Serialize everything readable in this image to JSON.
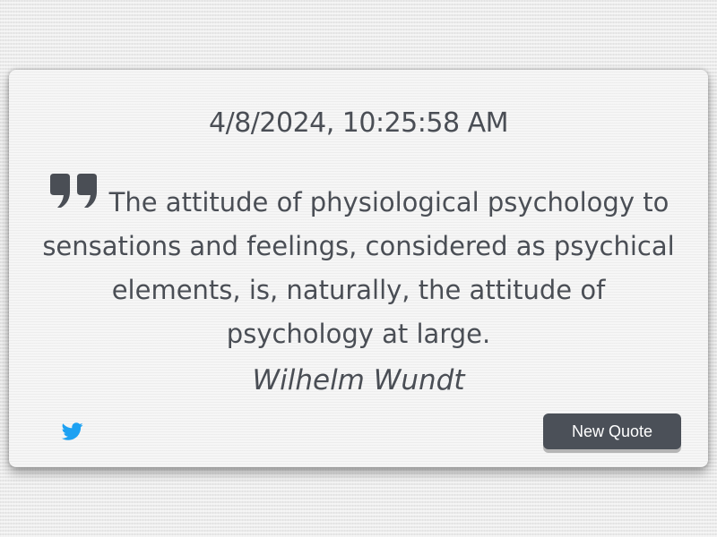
{
  "timestamp": "4/8/2024, 10:25:58 AM",
  "quote": {
    "text": "The attitude of physiological psychology to sensations and feelings, considered as psychical elements, is, naturally, the attitude of psychology at large.",
    "author": "Wilhelm Wundt"
  },
  "actions": {
    "tweet_icon": "twitter-icon",
    "new_quote_label": "New Quote"
  },
  "colors": {
    "text": "#4a4e55",
    "button_bg": "#4b5058",
    "twitter_blue": "#1da1f2"
  }
}
